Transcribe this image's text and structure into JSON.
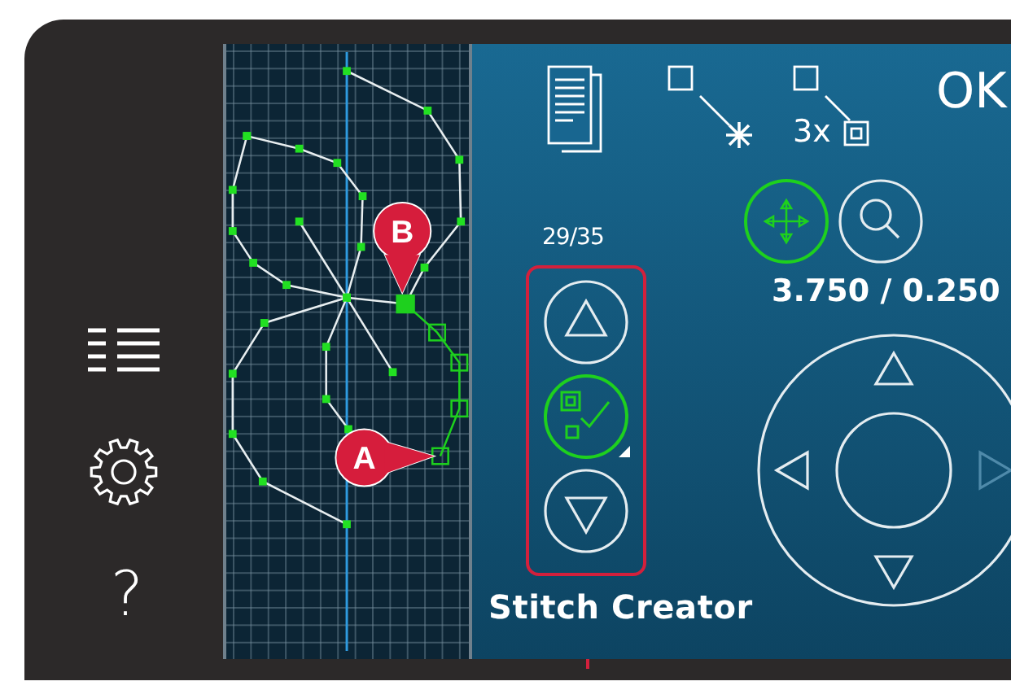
{
  "sidebar": {
    "help_label": "?"
  },
  "canvas": {
    "markers": [
      {
        "label": "B"
      },
      {
        "label": "A"
      }
    ]
  },
  "toolbar": {
    "repeat_label": "3x",
    "ok_label": "OK"
  },
  "tools": [
    {
      "kind": "move",
      "on": true
    },
    {
      "kind": "zoom",
      "on": false
    }
  ],
  "position": "3.750 / 0.250",
  "stitch_counter": "29/35",
  "stitch_nav": [
    {
      "kind": "up",
      "on": false
    },
    {
      "kind": "select",
      "on": true
    },
    {
      "kind": "down",
      "on": false
    }
  ],
  "wheel": {
    "arrows": [
      {
        "kind": "up",
        "disabled": false
      },
      {
        "kind": "left",
        "disabled": false
      },
      {
        "kind": "down",
        "disabled": false
      },
      {
        "kind": "right",
        "disabled": true
      }
    ]
  },
  "title": "Stitch Creator"
}
